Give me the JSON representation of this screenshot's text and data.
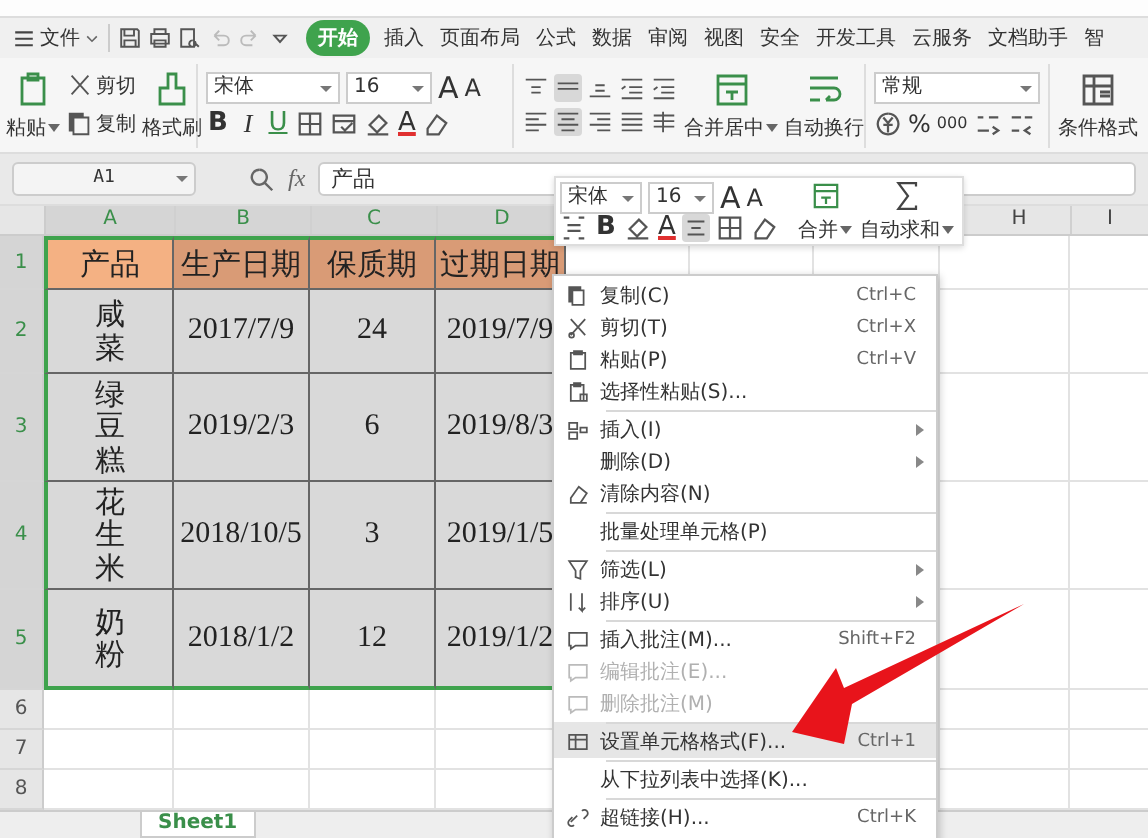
{
  "menu_bar": {
    "file_menu": "文件",
    "tabs": [
      {
        "label": "开始",
        "selected": true
      },
      {
        "label": "插入",
        "selected": false
      },
      {
        "label": "页面布局",
        "selected": false
      },
      {
        "label": "公式",
        "selected": false
      },
      {
        "label": "数据",
        "selected": false
      },
      {
        "label": "审阅",
        "selected": false
      },
      {
        "label": "视图",
        "selected": false
      },
      {
        "label": "安全",
        "selected": false
      },
      {
        "label": "开发工具",
        "selected": false
      },
      {
        "label": "云服务",
        "selected": false
      },
      {
        "label": "文档助手",
        "selected": false
      },
      {
        "label": "智",
        "selected": false
      }
    ]
  },
  "ribbon": {
    "paste": "粘贴",
    "cut": "剪切",
    "copy": "复制",
    "format_painter": "格式刷",
    "font_name": "宋体",
    "font_size": "16",
    "grow_font": "A",
    "shrink_font": "A",
    "style_buttons": [
      "B",
      "I",
      "U"
    ],
    "font_color": "A",
    "merge_center": "合并居中",
    "wrap_text": "自动换行",
    "number_format": "常规",
    "percent": "%",
    "thousands": "000",
    "conditional_format": "条件格式"
  },
  "formula_bar": {
    "name_box": "A1",
    "fx": "fx",
    "formula": "产品"
  },
  "sheet": {
    "range_selected": true,
    "columns": [
      "A",
      "B",
      "C",
      "D",
      "H",
      "I"
    ],
    "row_numbers": [
      "1",
      "2",
      "3",
      "4",
      "5",
      "6",
      "7",
      "8"
    ],
    "rows": [
      {
        "kind": "header",
        "cells": [
          "产品",
          "生产日期",
          "保质期",
          "过期日期"
        ]
      },
      {
        "kind": "data",
        "cells": [
          "咸菜",
          "2017/7/9",
          "24",
          "2019/7/9"
        ]
      },
      {
        "kind": "data",
        "cells": [
          "绿豆糕",
          "2019/2/3",
          "6",
          "2019/8/3"
        ]
      },
      {
        "kind": "data",
        "cells": [
          "花生米",
          "2018/10/5",
          "3",
          "2019/1/5"
        ]
      },
      {
        "kind": "data",
        "cells": [
          "奶粉",
          "2018/1/2",
          "12",
          "2019/1/2"
        ]
      }
    ],
    "sheet_tab": "Sheet1"
  },
  "mini_toolbar": {
    "font_name": "宋体",
    "font_size": "16",
    "grow_font": "A",
    "shrink_font": "A",
    "bold": "B",
    "font_color": "A",
    "merge": "合并",
    "auto_sum": "自动求和"
  },
  "context_menu": [
    {
      "label": "复制(C)",
      "shortcut": "Ctrl+C",
      "has_submenu": false,
      "disabled": false,
      "selected": false,
      "separator_before": false
    },
    {
      "label": "剪切(T)",
      "shortcut": "Ctrl+X",
      "has_submenu": false,
      "disabled": false,
      "selected": false,
      "separator_before": false
    },
    {
      "label": "粘贴(P)",
      "shortcut": "Ctrl+V",
      "has_submenu": false,
      "disabled": false,
      "selected": false,
      "separator_before": false
    },
    {
      "label": "选择性粘贴(S)...",
      "has_submenu": false,
      "disabled": false,
      "selected": false,
      "separator_before": false
    },
    {
      "label": "插入(I)",
      "has_submenu": true,
      "disabled": false,
      "selected": false,
      "separator_before": true
    },
    {
      "label": "删除(D)",
      "has_submenu": true,
      "disabled": false,
      "selected": false,
      "separator_before": false
    },
    {
      "label": "清除内容(N)",
      "has_submenu": false,
      "disabled": false,
      "selected": false,
      "separator_before": false
    },
    {
      "label": "批量处理单元格(P)",
      "has_submenu": false,
      "disabled": false,
      "selected": false,
      "separator_before": true
    },
    {
      "label": "筛选(L)",
      "has_submenu": true,
      "disabled": false,
      "selected": false,
      "separator_before": true
    },
    {
      "label": "排序(U)",
      "has_submenu": true,
      "disabled": false,
      "selected": false,
      "separator_before": false
    },
    {
      "label": "插入批注(M)...",
      "shortcut": "Shift+F2",
      "has_submenu": false,
      "disabled": false,
      "selected": false,
      "separator_before": true
    },
    {
      "label": "编辑批注(E)...",
      "has_submenu": false,
      "disabled": true,
      "selected": false,
      "separator_before": false
    },
    {
      "label": "删除批注(M)",
      "has_submenu": false,
      "disabled": true,
      "selected": false,
      "separator_before": false
    },
    {
      "label": "设置单元格格式(F)...",
      "shortcut": "Ctrl+1",
      "has_submenu": false,
      "disabled": false,
      "selected": true,
      "separator_before": true
    },
    {
      "label": "从下拉列表中选择(K)...",
      "has_submenu": false,
      "disabled": false,
      "selected": false,
      "separator_before": true
    },
    {
      "label": "超链接(H)...",
      "shortcut": "Ctrl+K",
      "has_submenu": false,
      "disabled": false,
      "selected": false,
      "separator_before": true
    }
  ]
}
